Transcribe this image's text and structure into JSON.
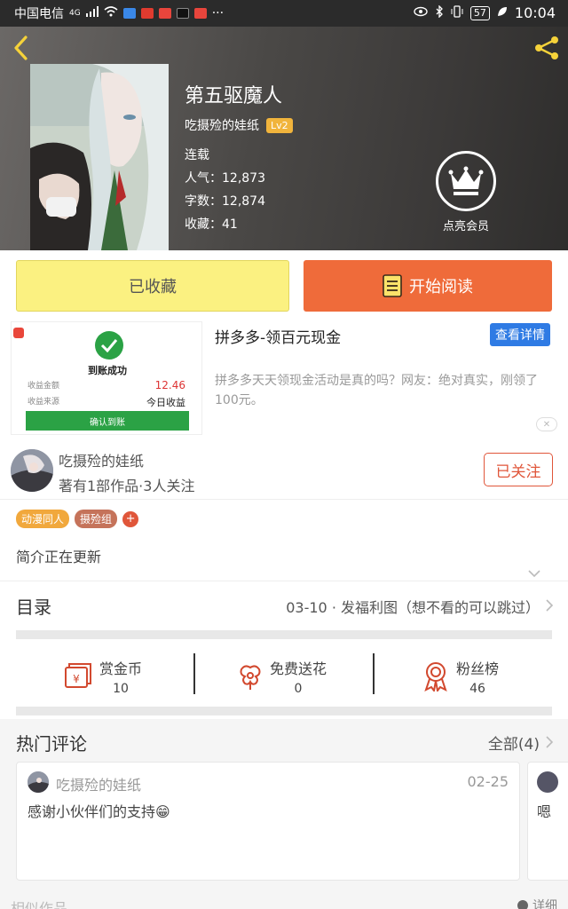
{
  "status_bar": {
    "carrier": "中国电信",
    "network": "4G",
    "battery": "57",
    "time": "10:04"
  },
  "book": {
    "title": "第五驱魔人",
    "author": "吃摄殓的娃纸",
    "level": "Lv2",
    "status": "连载",
    "popularity": "人气：12,873",
    "word_count": "字数：12,874",
    "favorites": "收藏：41",
    "vip_label": "点亮会员"
  },
  "actions": {
    "favorited_label": "已收藏",
    "read_label": "开始阅读"
  },
  "ad": {
    "title": "拼多多-领百元现金",
    "detail_label": "查看详情",
    "description": "拼多多天天领现金活动是真的吗？网友：绝对真实，刚领了100元。",
    "image": {
      "success_text": "到账成功",
      "amount_label": "收益金额",
      "amount_value": "12.46",
      "source_label": "收益来源",
      "source_value": "今日收益",
      "confirm_label": "确认到账"
    },
    "close_label": "✕"
  },
  "author_card": {
    "name": "吃摄殓的娃纸",
    "summary": "著有1部作品·3人关注",
    "followed_label": "已关注",
    "tags": [
      {
        "label": "动漫同人",
        "color": "#f1a83c"
      },
      {
        "label": "摄殓组",
        "color": "#c5735a"
      }
    ],
    "tag_add": "+",
    "intro": "简介正在更新"
  },
  "toc": {
    "label": "目录",
    "latest": "03-10 · 发福利图（想不看的可以跳过）"
  },
  "stats": [
    {
      "label": "赏金币",
      "value": "10",
      "icon": "reward-envelope-icon"
    },
    {
      "label": "免费送花",
      "value": "0",
      "icon": "flower-icon"
    },
    {
      "label": "粉丝榜",
      "value": "46",
      "icon": "medal-icon"
    }
  ],
  "comments": {
    "label": "热门评论",
    "all_label": "全部(4)",
    "items": [
      {
        "name": "吃摄殓的娃纸",
        "date": "02-25",
        "text": "感谢小伙伴们的支持😁"
      },
      {
        "text": "嗯"
      }
    ]
  },
  "footer": {
    "left": "相似作品",
    "right": "详细"
  },
  "colors": {
    "accent": "#ef6b3a",
    "favorite_bg": "#fbf181",
    "ad_button": "#2f7be4",
    "success_green": "#2ba245"
  }
}
